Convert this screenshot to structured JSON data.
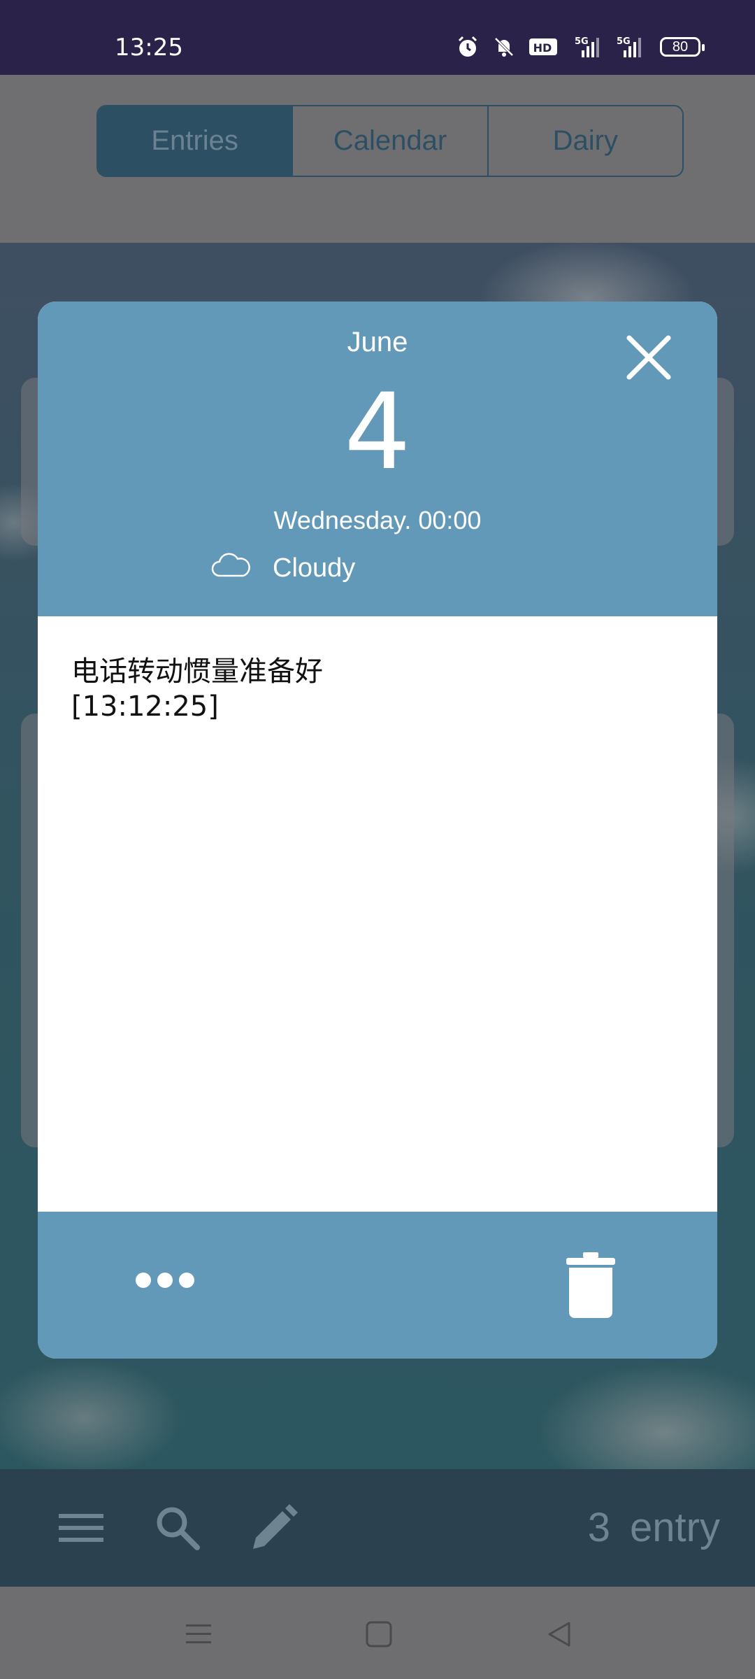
{
  "status_bar": {
    "time": "13:25",
    "icons": [
      "alarm-icon",
      "mute-icon",
      "hd-icon",
      "5g-signal-icon",
      "5g-signal-icon-2"
    ],
    "hd_label": "HD",
    "network_label": "5G",
    "battery": "80"
  },
  "tabs": [
    {
      "label": "Entries",
      "active": true
    },
    {
      "label": "Calendar",
      "active": false
    },
    {
      "label": "Dairy",
      "active": false
    }
  ],
  "dialog": {
    "month": "June",
    "day": "4",
    "weekday_time": "Wednesday.  00:00",
    "weather_icon": "cloud-icon",
    "weather": "Cloudy",
    "entry_text": "电话转动惯量准备好\n[13:12:25]",
    "close_icon": "close-icon",
    "more_icon": "more-icon",
    "delete_icon": "trash-icon"
  },
  "bottom_bar": {
    "icons": [
      "menu-icon",
      "search-icon",
      "edit-icon"
    ],
    "count": "3",
    "count_label": "entry"
  },
  "system_nav": [
    "recents-icon",
    "home-icon",
    "back-icon"
  ],
  "colors": {
    "status_bar": "#2a2248",
    "dialog_accent": "#6399b8",
    "tab_active": "#2d4f63"
  }
}
